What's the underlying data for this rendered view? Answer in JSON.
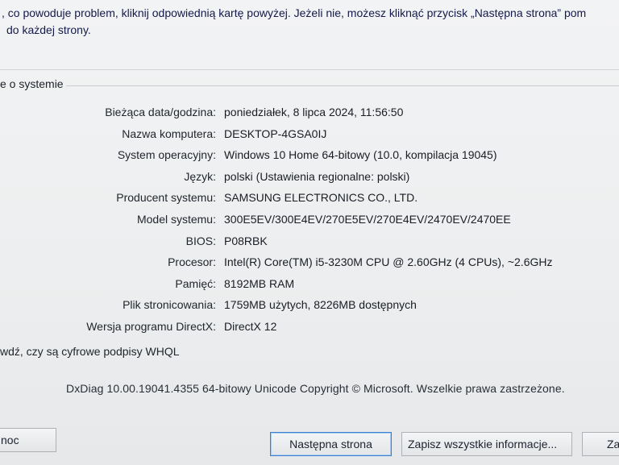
{
  "intro": {
    "line1": ", co powoduje problem, kliknij odpowiednią kartę powyżej. Jeżeli nie, możesz kliknąć przycisk „Następna strona” pom",
    "line2": "do każdej strony."
  },
  "system_group": {
    "title": "e o systemie",
    "rows": [
      {
        "label": "Bieżąca data/godzina:",
        "value": "poniedziałek, 8 lipca 2024, 11:56:50"
      },
      {
        "label": "Nazwa komputera:",
        "value": "DESKTOP-4GSA0IJ"
      },
      {
        "label": "System operacyjny:",
        "value": "Windows 10 Home 64-bitowy (10.0, kompilacja 19045)"
      },
      {
        "label": "Język:",
        "value": "polski (Ustawienia regionalne: polski)"
      },
      {
        "label": "Producent systemu:",
        "value": "SAMSUNG ELECTRONICS CO., LTD."
      },
      {
        "label": "Model systemu:",
        "value": "300E5EV/300E4EV/270E5EV/270E4EV/2470EV/2470EE"
      },
      {
        "label": "BIOS:",
        "value": "P08RBK"
      },
      {
        "label": "Procesor:",
        "value": "Intel(R) Core(TM) i5-3230M CPU @ 2.60GHz (4 CPUs), ~2.6GHz"
      },
      {
        "label": "Pamięć:",
        "value": "8192MB RAM"
      },
      {
        "label": "Plik stronicowania:",
        "value": "1759MB użytych, 8226MB dostępnych"
      },
      {
        "label": "Wersja programu DirectX:",
        "value": "DirectX 12"
      }
    ]
  },
  "whql": {
    "label": "wdź, czy są cyfrowe podpisy WHQL"
  },
  "footer": {
    "text": "DxDiag 10.00.19041.4355 64-bitowy Unicode  Copyright © Microsoft. Wszelkie prawa zastrzeżone."
  },
  "buttons": {
    "help": "noc",
    "next": "Następna strona",
    "save_all": "Zapisz wszystkie informacje...",
    "exit": "Za"
  }
}
